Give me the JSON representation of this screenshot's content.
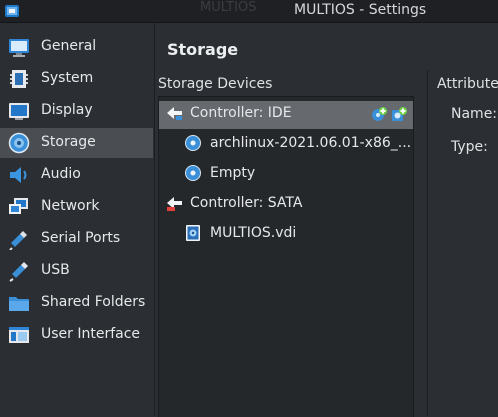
{
  "window": {
    "title": "MULTIOS - Settings",
    "ghost_title": "MULTIOS"
  },
  "sidebar": {
    "items": [
      {
        "label": "General",
        "icon": "general-icon"
      },
      {
        "label": "System",
        "icon": "system-icon"
      },
      {
        "label": "Display",
        "icon": "display-icon"
      },
      {
        "label": "Storage",
        "icon": "storage-icon",
        "selected": true
      },
      {
        "label": "Audio",
        "icon": "audio-icon"
      },
      {
        "label": "Network",
        "icon": "network-icon"
      },
      {
        "label": "Serial Ports",
        "icon": "serial-ports-icon"
      },
      {
        "label": "USB",
        "icon": "usb-icon"
      },
      {
        "label": "Shared Folders",
        "icon": "shared-folders-icon"
      },
      {
        "label": "User Interface",
        "icon": "user-interface-icon"
      }
    ]
  },
  "main": {
    "title": "Storage",
    "storage_devices_label": "Storage Devices",
    "tree": [
      {
        "label": "Controller: IDE",
        "type": "controller",
        "selected": true
      },
      {
        "label": "archlinux-2021.06.01-x86_...",
        "type": "optical"
      },
      {
        "label": "Empty",
        "type": "optical"
      },
      {
        "label": "Controller: SATA",
        "type": "controller"
      },
      {
        "label": "MULTIOS.vdi",
        "type": "disk"
      }
    ]
  },
  "attributes": {
    "title": "Attributes",
    "name_label": "Name:",
    "type_label": "Type:"
  },
  "colors": {
    "background": "#2b2e32",
    "selection": "#4a4e53",
    "tree_selection": "#66696d",
    "accent_blue": "#3a8fd9",
    "add_green": "#6fd24a"
  }
}
